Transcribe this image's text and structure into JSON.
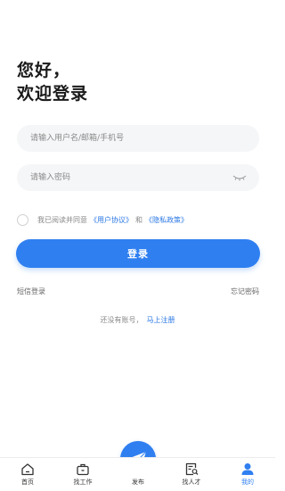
{
  "greeting": {
    "line1": "您好，",
    "line2": "欢迎登录"
  },
  "form": {
    "username_placeholder": "请输入用户名/邮箱/手机号",
    "password_placeholder": "请输入密码"
  },
  "agreement": {
    "prefix": "我已阅读并同意",
    "user_agreement": "《用户协议》",
    "and": "和",
    "privacy_policy": "《隐私政策》"
  },
  "login_button": "登录",
  "links": {
    "sms_login": "短信登录",
    "forgot_password": "忘记密码"
  },
  "register": {
    "prompt": "还没有账号，",
    "link": "马上注册"
  },
  "tabbar": {
    "items": [
      {
        "label": "首页",
        "icon": "home-icon"
      },
      {
        "label": "找工作",
        "icon": "briefcase-icon"
      },
      {
        "label": "发布",
        "icon": "paper-plane-icon"
      },
      {
        "label": "找人才",
        "icon": "resume-search-icon"
      },
      {
        "label": "我的",
        "icon": "user-icon",
        "active": true
      }
    ]
  },
  "colors": {
    "accent": "#2f7ff0",
    "link": "#2b78e4",
    "input_bg": "#f5f6f8"
  }
}
